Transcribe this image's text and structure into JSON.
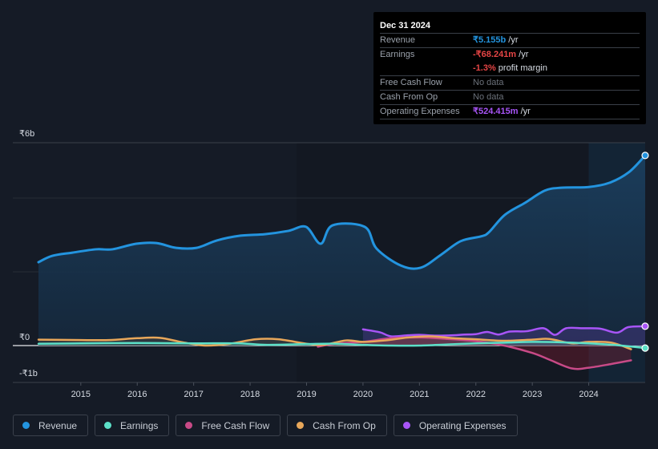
{
  "tooltip": {
    "date": "Dec 31 2024",
    "rows": [
      {
        "label": "Revenue",
        "value": "₹5.155b",
        "suffix": " /yr"
      },
      {
        "label": "Earnings",
        "value": "-₹68.241m",
        "suffix": " /yr"
      },
      {
        "label": "",
        "value": "-1.3%",
        "suffix": " profit margin"
      },
      {
        "label": "Free Cash Flow",
        "value": "No data",
        "suffix": ""
      },
      {
        "label": "Cash From Op",
        "value": "No data",
        "suffix": ""
      },
      {
        "label": "Operating Expenses",
        "value": "₹524.415m",
        "suffix": " /yr"
      }
    ]
  },
  "legend": [
    {
      "label": "Revenue",
      "color": "#2394df"
    },
    {
      "label": "Earnings",
      "color": "#5ce0c8"
    },
    {
      "label": "Free Cash Flow",
      "color": "#c84a87"
    },
    {
      "label": "Cash From Op",
      "color": "#e8a75a"
    },
    {
      "label": "Operating Expenses",
      "color": "#a855f7"
    }
  ],
  "chart_data": {
    "type": "area",
    "title": "",
    "xlabel": "",
    "ylabel": "",
    "currency": "₹",
    "units": "billions INR",
    "xlim": [
      2014.25,
      2025.0
    ],
    "ylim": [
      -1.0,
      5.5
    ],
    "y_tick_labels": [
      {
        "value": 6,
        "label": "₹6b"
      },
      {
        "value": 0,
        "label": "₹0"
      },
      {
        "value": -1,
        "label": "-₹1b"
      }
    ],
    "x_ticks": [
      2015,
      2016,
      2017,
      2018,
      2019,
      2020,
      2021,
      2022,
      2023,
      2024
    ],
    "highlight_range": [
      2024.0,
      2025.0
    ],
    "grid": true,
    "series": [
      {
        "name": "Revenue",
        "color": "#2394df",
        "x": [
          2014.25,
          2014.49,
          2014.85,
          2015.27,
          2015.56,
          2015.98,
          2016.34,
          2016.69,
          2017.05,
          2017.41,
          2017.83,
          2018.26,
          2018.68,
          2018.99,
          2019.25,
          2019.46,
          2020.03,
          2020.24,
          2020.67,
          2021.02,
          2021.38,
          2021.73,
          2022.09,
          2022.23,
          2022.51,
          2022.87,
          2023.22,
          2023.51,
          2024.0,
          2024.36,
          2024.71,
          2025.0
        ],
        "values": [
          2.26,
          2.43,
          2.52,
          2.61,
          2.61,
          2.76,
          2.78,
          2.65,
          2.65,
          2.85,
          2.98,
          3.02,
          3.11,
          3.22,
          2.76,
          3.26,
          3.22,
          2.63,
          2.17,
          2.11,
          2.46,
          2.83,
          2.96,
          3.07,
          3.54,
          3.87,
          4.2,
          4.28,
          4.3,
          4.41,
          4.7,
          5.155
        ]
      },
      {
        "name": "Earnings",
        "color": "#5ce0c8",
        "x": [
          2014.25,
          2015.0,
          2016.0,
          2017.0,
          2017.8,
          2018.3,
          2019.0,
          2019.5,
          2020.0,
          2020.5,
          2021.0,
          2021.5,
          2022.0,
          2022.5,
          2023.0,
          2023.5,
          2024.0,
          2024.5,
          2025.0
        ],
        "values": [
          0.05,
          0.06,
          0.07,
          0.06,
          0.06,
          0.02,
          0.04,
          0.05,
          0.02,
          0.0,
          0.0,
          0.03,
          0.06,
          0.08,
          0.1,
          0.09,
          0.06,
          0.01,
          -0.068
        ]
      },
      {
        "name": "Free Cash Flow",
        "color": "#c84a87",
        "x": [
          2019.2,
          2019.5,
          2020.0,
          2020.5,
          2021.0,
          2021.5,
          2022.0,
          2022.5,
          2023.0,
          2023.3,
          2023.7,
          2024.0,
          2024.4,
          2024.75
        ],
        "values": [
          -0.03,
          0.05,
          0.1,
          0.2,
          0.22,
          0.18,
          0.12,
          0.0,
          -0.2,
          -0.38,
          -0.62,
          -0.6,
          -0.5,
          -0.4
        ]
      },
      {
        "name": "Cash From Op",
        "color": "#e8a75a",
        "x": [
          2014.25,
          2015.0,
          2015.5,
          2016.0,
          2016.4,
          2016.8,
          2017.2,
          2017.6,
          2018.1,
          2018.5,
          2019.0,
          2019.3,
          2019.7,
          2020.0,
          2020.4,
          2020.8,
          2021.2,
          2021.6,
          2022.0,
          2022.5,
          2023.0,
          2023.3,
          2023.7,
          2024.0,
          2024.4,
          2024.75
        ],
        "values": [
          0.16,
          0.15,
          0.15,
          0.2,
          0.21,
          0.09,
          0.0,
          0.04,
          0.17,
          0.17,
          0.05,
          0.02,
          0.14,
          0.1,
          0.14,
          0.22,
          0.25,
          0.2,
          0.17,
          0.13,
          0.16,
          0.18,
          0.06,
          0.1,
          0.08,
          -0.1
        ]
      },
      {
        "name": "Operating Expenses",
        "color": "#a855f7",
        "x": [
          2020.0,
          2020.3,
          2020.5,
          2020.8,
          2021.0,
          2021.3,
          2021.6,
          2021.8,
          2022.0,
          2022.2,
          2022.4,
          2022.6,
          2022.9,
          2023.2,
          2023.4,
          2023.6,
          2023.9,
          2024.2,
          2024.5,
          2024.7,
          2025.0
        ],
        "values": [
          0.44,
          0.36,
          0.25,
          0.28,
          0.29,
          0.27,
          0.28,
          0.3,
          0.31,
          0.37,
          0.3,
          0.38,
          0.39,
          0.47,
          0.29,
          0.47,
          0.47,
          0.46,
          0.35,
          0.5,
          0.524
        ]
      }
    ]
  }
}
